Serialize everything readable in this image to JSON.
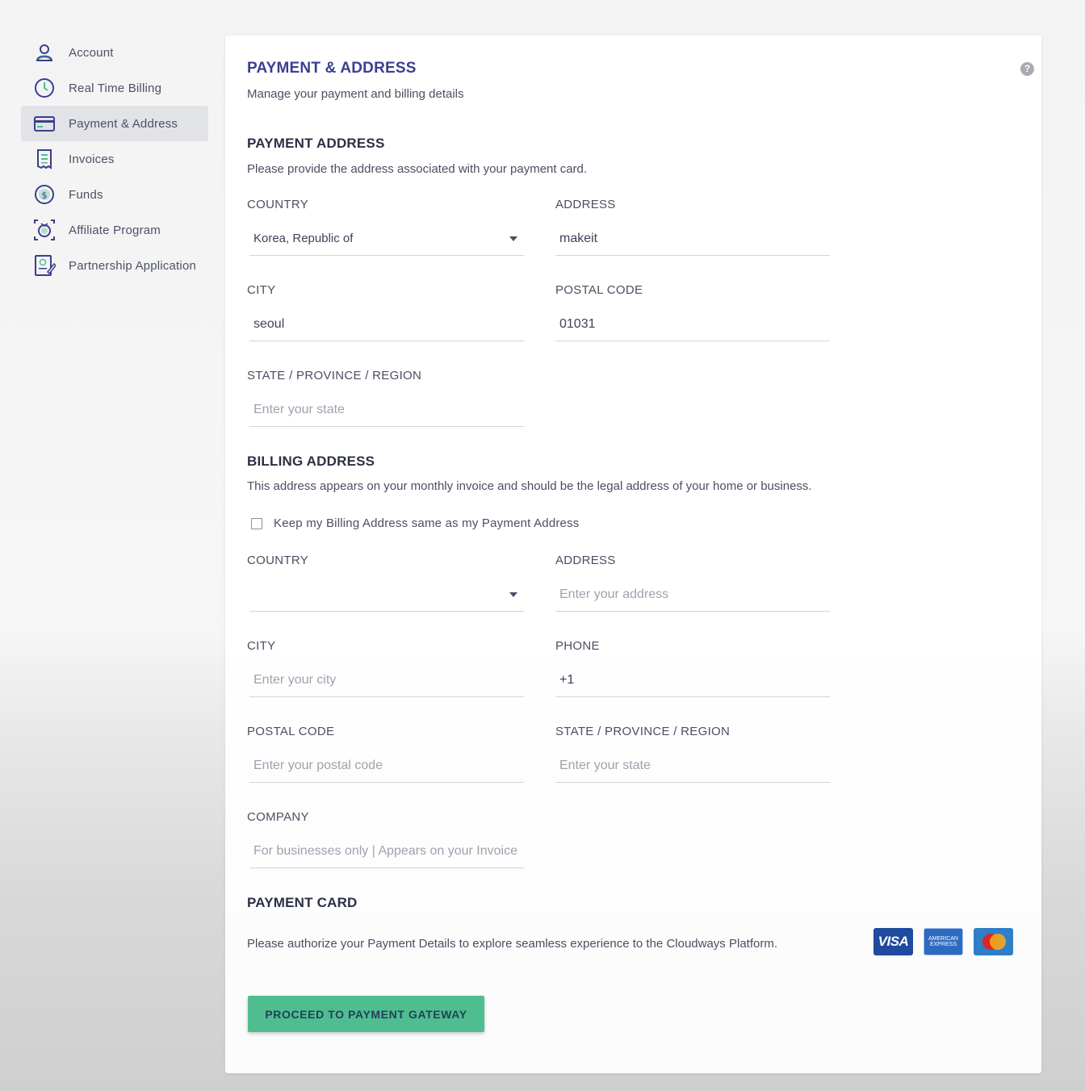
{
  "sidebar": {
    "items": [
      {
        "label": "Account",
        "icon": "user-icon"
      },
      {
        "label": "Real Time Billing",
        "icon": "clock-icon"
      },
      {
        "label": "Payment & Address",
        "icon": "credit-card-icon",
        "active": true
      },
      {
        "label": "Invoices",
        "icon": "receipt-icon"
      },
      {
        "label": "Funds",
        "icon": "dollar-coin-icon"
      },
      {
        "label": "Affiliate Program",
        "icon": "affiliate-icon"
      },
      {
        "label": "Partnership Application",
        "icon": "application-form-icon"
      }
    ]
  },
  "header": {
    "title": "PAYMENT & ADDRESS",
    "subtitle": "Manage your payment and billing details",
    "help": "?"
  },
  "payment_address": {
    "title": "PAYMENT ADDRESS",
    "description": "Please provide the address associated with your payment card.",
    "country_label": "COUNTRY",
    "country_value": "Korea, Republic of",
    "address_label": "ADDRESS",
    "address_value": "makeit",
    "city_label": "CITY",
    "city_value": "seoul",
    "postal_label": "POSTAL CODE",
    "postal_value": "01031",
    "state_label": "STATE / PROVINCE / REGION",
    "state_placeholder": "Enter your state"
  },
  "billing_address": {
    "title": "BILLING ADDRESS",
    "description": "This address appears on your monthly invoice and should be the legal address of your home or business.",
    "same_checkbox_label": "Keep my Billing Address same as my Payment Address",
    "country_label": "COUNTRY",
    "country_value": "",
    "address_label": "ADDRESS",
    "address_placeholder": "Enter your address",
    "city_label": "CITY",
    "city_placeholder": "Enter your city",
    "phone_label": "PHONE",
    "phone_value": "+1",
    "postal_label": "POSTAL CODE",
    "postal_placeholder": "Enter your postal code",
    "state_label": "STATE / PROVINCE / REGION",
    "state_placeholder": "Enter your state",
    "company_label": "COMPANY",
    "company_placeholder": "For businesses only | Appears on your Invoice"
  },
  "payment_card": {
    "title": "PAYMENT CARD",
    "description": "Please authorize your Payment Details to explore seamless experience to the Cloudways Platform.",
    "logos": {
      "visa": "VISA",
      "amex_line1": "AMERICAN",
      "amex_line2": "EXPRESS"
    },
    "button_label": "PROCEED TO PAYMENT GATEWAY"
  },
  "colors": {
    "title": "#3a3f8f",
    "button": "#4fbd8f",
    "icon_stroke": "#3a3f8f",
    "icon_accent": "#4fbd8f"
  }
}
